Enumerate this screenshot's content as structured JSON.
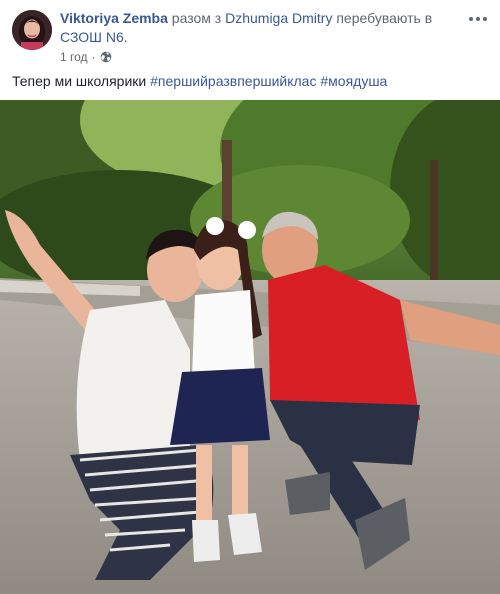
{
  "post": {
    "author": "Viktoriya Zemba",
    "with_word": "разом з",
    "tagged_person": "Dzhumiga Dmitry",
    "location_prefix": "перебувають в",
    "location": "СЗОШ N6.",
    "time": "1 год",
    "privacy_icon": "globe-icon",
    "text": "Тепер ми школярики",
    "hashtags": [
      "#першийразвпершийклас",
      "#моядуша"
    ],
    "more_icon": "more-icon"
  },
  "colors": {
    "link": "#385898",
    "secondary_text": "#616770",
    "text": "#1d2129"
  }
}
